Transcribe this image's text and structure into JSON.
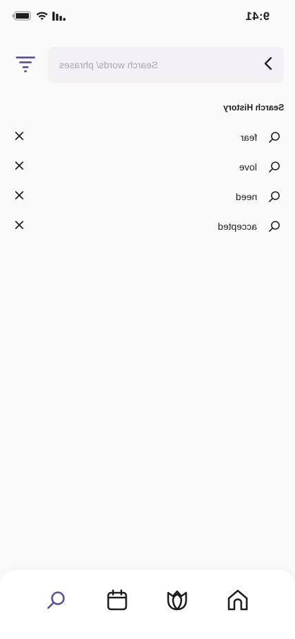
{
  "status_bar": {
    "time": "9:41"
  },
  "search": {
    "placeholder": "Search words/ phrases",
    "value": ""
  },
  "history": {
    "title": "Search History",
    "items": [
      {
        "label": "fear"
      },
      {
        "label": "love"
      },
      {
        "label": "need"
      },
      {
        "label": "accepted"
      }
    ]
  },
  "bottom_nav": {
    "items": [
      {
        "icon": "search-icon",
        "active": true
      },
      {
        "icon": "calendar-icon",
        "active": false
      },
      {
        "icon": "lotus-icon",
        "active": false
      },
      {
        "icon": "home-icon",
        "active": false
      }
    ]
  },
  "colors": {
    "accent": "#5b4a9b",
    "text": "#1e1e1e",
    "background": "#fafafa",
    "search_bg": "#f3f1f6",
    "placeholder": "#a8a6ab"
  }
}
